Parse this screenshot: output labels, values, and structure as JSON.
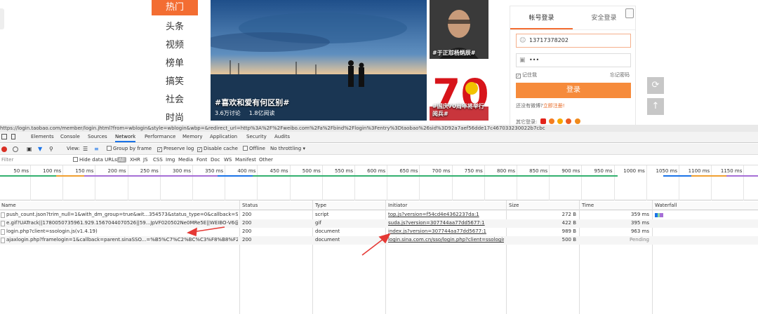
{
  "nav": {
    "items": [
      {
        "label": "热门",
        "active": true
      },
      {
        "label": "头条"
      },
      {
        "label": "视频"
      },
      {
        "label": "榜单"
      },
      {
        "label": "搞笑"
      },
      {
        "label": "社会"
      },
      {
        "label": "时尚"
      }
    ]
  },
  "hero": {
    "title": "#喜欢和爱有何区别#",
    "discuss": "3.6万讨论",
    "reads": "1.8亿阅读"
  },
  "thumbs": [
    {
      "caption": "#于正怼杨炳辰#"
    },
    {
      "caption": "#国庆70周年将举行阅兵#"
    }
  ],
  "login": {
    "tabs": [
      "帐号登录",
      "安全登录"
    ],
    "username": "13717378202",
    "password": "•••",
    "remember": "记住我",
    "forgot": "忘记密码",
    "button": "登录",
    "no_account": "还没有微博?",
    "register": "立即注册!",
    "other_login": "其它登录:",
    "social_colors": [
      "#e2231a",
      "#f47d20",
      "#f7a600",
      "#ec5a21",
      "#f08a1c"
    ]
  },
  "side_buttons": {
    "refresh": "refresh-icon",
    "top": "arrow-up-icon"
  },
  "devtools": {
    "url": "https://login.taobao.com/member/login.jhtml?from=wblogin&style=wblogin&wbp=&redirect_url=http%3A%2F%2Fweibo.com%2Fa%2Fbind%2Flogin%3Fentry%3Dtaobao%26sid%3D92a7aef56dde17c467033230022b7cbc",
    "tabs": [
      "Elements",
      "Console",
      "Sources",
      "Network",
      "Performance",
      "Memory",
      "Application",
      "Security",
      "Audits"
    ],
    "active_tab": "Network",
    "toolbar": {
      "view": "View:",
      "group_by_frame": "Group by frame",
      "preserve_log": "Preserve log",
      "disable_cache": "Disable cache",
      "offline": "Offline",
      "throttling": "No throttling"
    },
    "filter": {
      "placeholder": "Filter",
      "hide_data_urls": "Hide data URLs",
      "types": [
        "All",
        "XHR",
        "JS",
        "CSS",
        "Img",
        "Media",
        "Font",
        "Doc",
        "WS",
        "Manifest",
        "Other"
      ]
    },
    "timeline_ticks": [
      "50 ms",
      "100 ms",
      "150 ms",
      "200 ms",
      "250 ms",
      "300 ms",
      "350 ms",
      "400 ms",
      "450 ms",
      "500 ms",
      "550 ms",
      "600 ms",
      "650 ms",
      "700 ms",
      "750 ms",
      "800 ms",
      "850 ms",
      "900 ms",
      "950 ms",
      "1000 ms",
      "1050 ms",
      "1100 ms",
      "1150 ms",
      "1200"
    ],
    "columns": [
      "Name",
      "Status",
      "Type",
      "Initiator",
      "Size",
      "Time",
      "Waterfall"
    ],
    "rows": [
      {
        "name": "push_count.json?trim_null=1&with_dm_group=true&wit...354573&status_type=0&callback=STK_1567...",
        "status": "200",
        "type": "script",
        "initiator": "top.js?version=f54cd4e4362237da:1",
        "size": "272 B",
        "time": "359 ms"
      },
      {
        "name": "e.gif?UATrack||1780050735961.929.1567044070526||59...JpVF020502Ne0MRe5E||WEIBO-V6@gUid_1...",
        "status": "200",
        "type": "gif",
        "initiator": "suda.js?version=307744aa77dd5677:1",
        "size": "422 B",
        "time": "395 ms"
      },
      {
        "name": "login.php?client=ssologin.js(v1.4.19)",
        "status": "200",
        "type": "document",
        "initiator": "index.js?version=307744aa77dd5677:1",
        "size": "989 B",
        "time": "963 ms"
      },
      {
        "name": "ajaxlogin.php?framelogin=1&callback=parent.sinaSSO...=%B5%C7%C2%BC%C3%F8%B8%F2%C3%D...",
        "status": "200",
        "type": "document",
        "initiator": "login.sina.com.cn/sso/login.php?client=ssologin.js(...",
        "size": "500 B",
        "time": "Pending"
      }
    ]
  }
}
